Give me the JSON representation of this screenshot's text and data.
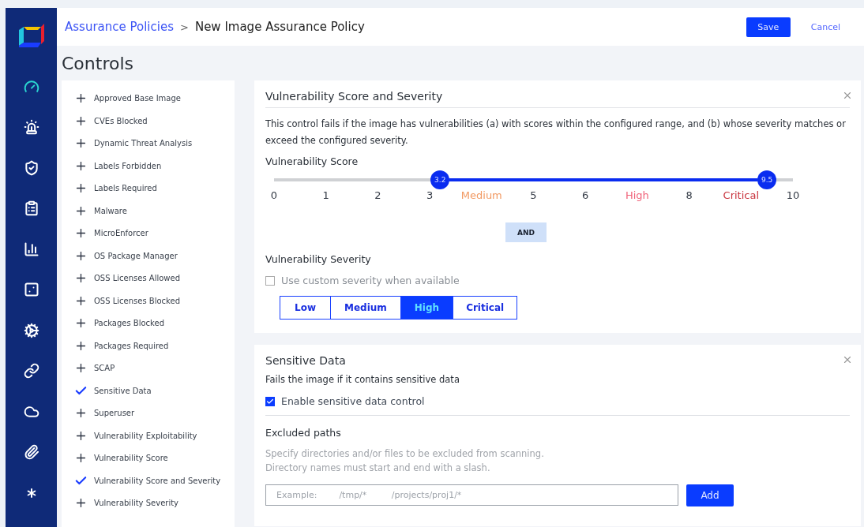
{
  "nav": [
    {
      "selected": true
    },
    {
      "selected": false
    },
    {
      "selected": false
    },
    {
      "selected": false
    },
    {
      "selected": false
    },
    {
      "selected": false
    },
    {
      "selected": false
    },
    {
      "selected": false
    },
    {
      "selected": false
    },
    {
      "selected": false
    },
    {
      "selected": false
    }
  ],
  "breadcrumb": {
    "parent": "Assurance Policies",
    "separator": ">",
    "current": "New Image Assurance Policy"
  },
  "actions": {
    "save": "Save",
    "cancel": "Cancel"
  },
  "page_title": "Controls",
  "controls": [
    {
      "label": "Approved Base Image",
      "added": false
    },
    {
      "label": "CVEs Blocked",
      "added": false
    },
    {
      "label": "Dynamic Threat Analysis",
      "added": false
    },
    {
      "label": "Labels Forbidden",
      "added": false
    },
    {
      "label": "Labels Required",
      "added": false
    },
    {
      "label": "Malware",
      "added": false
    },
    {
      "label": "MicroEnforcer",
      "added": false
    },
    {
      "label": "OS Package Manager",
      "added": false
    },
    {
      "label": "OSS Licenses Allowed",
      "added": false
    },
    {
      "label": "OSS Licenses Blocked",
      "added": false
    },
    {
      "label": "Packages Blocked",
      "added": false
    },
    {
      "label": "Packages Required",
      "added": false
    },
    {
      "label": "SCAP",
      "added": false
    },
    {
      "label": "Sensitive Data",
      "added": true
    },
    {
      "label": "Superuser",
      "added": false
    },
    {
      "label": "Vulnerability Exploitability",
      "added": false
    },
    {
      "label": "Vulnerability Score",
      "added": false
    },
    {
      "label": "Vulnerability Score and Severity",
      "added": true
    },
    {
      "label": "Vulnerability Severity",
      "added": false
    }
  ],
  "score_card": {
    "title": "Vulnerability Score and Severity",
    "description": "This control fails if the image has vulnerabilities (a) with scores within the configured range, and (b) whose severity matches or exceed the configured severity.",
    "score_label": "Vulnerability Score",
    "slider": {
      "min": {
        "level": 0.32,
        "reading": "3.2"
      },
      "max": {
        "level": 0.95,
        "reading": "9.5"
      },
      "scale": [
        {
          "label": "0",
          "color": "#333a45"
        },
        {
          "label": "1",
          "color": "#333a45"
        },
        {
          "label": "2",
          "color": "#333a45"
        },
        {
          "label": "3",
          "color": "#333a45"
        },
        {
          "label": "Medium",
          "color": "#f29a63"
        },
        {
          "label": "5",
          "color": "#333a45"
        },
        {
          "label": "6",
          "color": "#333a45"
        },
        {
          "label": "High",
          "color": "#f0637a"
        },
        {
          "label": "8",
          "color": "#333a45"
        },
        {
          "label": "Critical",
          "color": "#c8323c"
        },
        {
          "label": "10",
          "color": "#333a45"
        }
      ]
    },
    "joiner": "AND",
    "severity_label": "Vulnerability Severity",
    "custom_severity": {
      "label": "Use custom severity when available",
      "checked": false
    },
    "severities": [
      {
        "label": "Low",
        "selected": false
      },
      {
        "label": "Medium",
        "selected": false
      },
      {
        "label": "High",
        "selected": true
      },
      {
        "label": "Critical",
        "selected": false
      }
    ]
  },
  "sensitive_card": {
    "title": "Sensitive Data",
    "description": "Fails the image if it contains sensitive data",
    "enable": {
      "label": "Enable sensitive data control",
      "checked": true
    },
    "excluded_title": "Excluded paths",
    "help": [
      "Specify directories and/or files to be excluded from scanning.",
      "Directory names must start and end with a slash."
    ],
    "path_field": {
      "placeholder": "Example:        /tmp/*         /projects/proj1/*"
    },
    "add": "Add"
  }
}
